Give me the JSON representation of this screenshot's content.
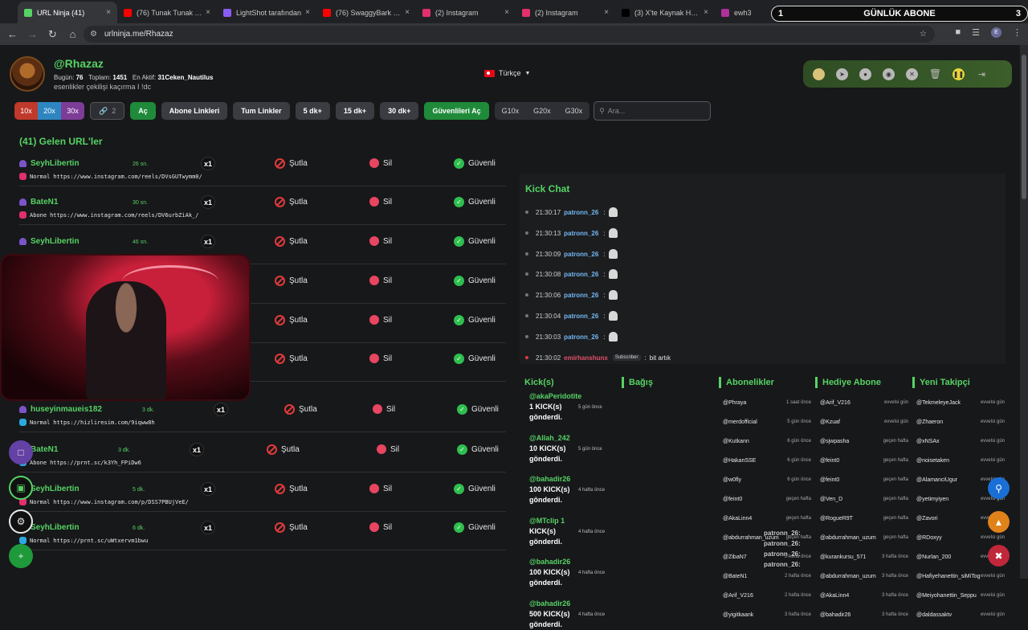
{
  "browser": {
    "tabs": [
      {
        "label": "URL Ninja (41)",
        "color": "#56d364",
        "active": true
      },
      {
        "label": "(76) Tunak Tunak Tun",
        "color": "#ff0000"
      },
      {
        "label": "LightShot tarafından",
        "color": "#8a5cf6"
      },
      {
        "label": "(76) SwaggyBark Kop",
        "color": "#ff0000"
      },
      {
        "label": "(2) Instagram",
        "color": "#e1306c"
      },
      {
        "label": "(2) Instagram",
        "color": "#e1306c"
      },
      {
        "label": "(3) X'te Kaynak Haber",
        "color": "#000000"
      },
      {
        "label": "ewh3",
        "color": "#b0309a"
      }
    ],
    "banner": {
      "left": "1",
      "text": "GÜNLÜK ABONE",
      "right": "3"
    },
    "url": "urlninja.me/Rhazaz"
  },
  "profile": {
    "username": "@Rhazaz",
    "today_label": "Bugün:",
    "today_value": "76",
    "total_label": "Toplam:",
    "total_value": "1451",
    "active_label": "En Aktif:",
    "active_value": "31Ceken_Nautilus",
    "tagline": "esenlikler çekilişi kaçırma I !dc",
    "language": "Türkçe"
  },
  "toolbar": {
    "mult": [
      {
        "label": "10x",
        "color": "#c0392b"
      },
      {
        "label": "20x",
        "color": "#2e86c1"
      },
      {
        "label": "30x",
        "color": "#7d3c98"
      }
    ],
    "link_count": "2",
    "open": "Aç",
    "sub_links": "Abone Linkleri",
    "all_links": "Tum Linkler",
    "t5": "5 dk+",
    "t15": "15 dk+",
    "t30": "30 dk+",
    "open_safe": "Güvenlileri Aç",
    "g10": "G10x",
    "g20": "G20x",
    "g30": "G30x",
    "search_placeholder": "Ara..."
  },
  "urls": {
    "title": "(41) Gelen URL'ler",
    "actions": {
      "ban": "Şutla",
      "del": "Sil",
      "safe": "Güvenli"
    },
    "rows": [
      {
        "user": "SeyhLibertin",
        "ago": "26 sn.",
        "badge": "x1",
        "type": "Normal",
        "url": "https://www.instagram.com/reels/DVsGUTwymm0/",
        "src": "ig"
      },
      {
        "user": "BateN1",
        "ago": "30 sn.",
        "badge": "x1",
        "type": "Abone",
        "url": "https://www.instagram.com/reels/DV6urbZiAk_/",
        "src": "ig"
      },
      {
        "user": "SeyhLibertin",
        "ago": "46 sn.",
        "badge": "x1",
        "type": "",
        "url": "",
        "src": ""
      },
      {
        "user": "",
        "ago": "",
        "badge": "",
        "type": "",
        "url": "",
        "src": ""
      },
      {
        "user": "",
        "ago": "",
        "badge": "",
        "type": "",
        "url": "",
        "src": ""
      },
      {
        "user": "",
        "ago": "",
        "badge": "",
        "type": "",
        "url": "",
        "src": ""
      },
      {
        "user": "huseyinmaueis182",
        "ago": "3 dk.",
        "badge": "x1",
        "type": "Normal",
        "url": "https://hizliresim.com/9iqww8h",
        "src": "tw"
      },
      {
        "user": "BateN1",
        "ago": "3 dk.",
        "badge": "x1",
        "type": "Abone",
        "url": "https://prnt.sc/k3Yh_FPiDw6",
        "src": "tw"
      },
      {
        "user": "SeyhLibertin",
        "ago": "5 dk.",
        "badge": "x1",
        "type": "Normal",
        "url": "https://www.instagram.com/p/DSS7PBUjVeE/",
        "src": "ig"
      },
      {
        "user": "SeyhLibertin",
        "ago": "6 dk.",
        "badge": "x1",
        "type": "Normal",
        "url": "https://prnt.sc/uWtxervm1bwu",
        "src": "tw"
      }
    ]
  },
  "chat": {
    "title": "Kick Chat",
    "messages": [
      {
        "time": "21:30:17",
        "nick": "patronn_26",
        "sep": ":",
        "text": ""
      },
      {
        "time": "21:30:13",
        "nick": "patronn_26",
        "sep": ":",
        "text": ""
      },
      {
        "time": "21:30:09",
        "nick": "patronn_26",
        "sep": ":",
        "text": ""
      },
      {
        "time": "21:30:08",
        "nick": "patronn_26",
        "sep": ":",
        "text": ""
      },
      {
        "time": "21:30:06",
        "nick": "patronn_26",
        "sep": ":",
        "text": ""
      },
      {
        "time": "21:30:04",
        "nick": "patronn_26",
        "sep": ":",
        "text": ""
      },
      {
        "time": "21:30:03",
        "nick": "patronn_26",
        "sep": ":",
        "text": ""
      },
      {
        "time": "21:30:02",
        "nick": "emirhanshunx",
        "badge": "Subscriber",
        "sep": ":",
        "text": "bit artık"
      }
    ]
  },
  "kicks": {
    "title": "Kick(s)",
    "items": [
      {
        "name": "@akaPeridotite",
        "line1": "1 KICK(s)",
        "line2": "gönderdi.",
        "when": "5 gün önce"
      },
      {
        "name": "@Allah_242",
        "line1": "10 KICK(s)",
        "line2": "gönderdi.",
        "when": "5 gün önce"
      },
      {
        "name": "@bahadir26",
        "line1": "100 KICK(s)",
        "line2": "gönderdi.",
        "when": "4 hafta önce"
      },
      {
        "name": "@MTclip 1",
        "line1": "KICK(s)",
        "line2": "gönderdi.",
        "when": "4 hafta önce"
      },
      {
        "name": "@bahadir26",
        "line1": "100 KICK(s)",
        "line2": "gönderdi.",
        "when": "4 hafta önce"
      },
      {
        "name": "@bahadir26",
        "line1": "500 KICK(s)",
        "line2": "gönderdi.",
        "when": "4 hafta önce"
      }
    ]
  },
  "donations": {
    "title": "Bağış"
  },
  "subs": {
    "title": "Abonelikler",
    "items": [
      {
        "n": "@Phraya",
        "w": "1 saat önce"
      },
      {
        "n": "@merdofficial",
        "w": "5 gün önce"
      },
      {
        "n": "@Kutkann",
        "w": "6 gün önce"
      },
      {
        "n": "@HakanSSE",
        "w": "6 gün önce"
      },
      {
        "n": "@w0fly",
        "w": "6 gün önce"
      },
      {
        "n": "@feint0",
        "w": "geçen hafta"
      },
      {
        "n": "@AkaLinn4",
        "w": "geçen hafta"
      },
      {
        "n": "@abdurrahman_uzum",
        "w": "geçen hafta"
      },
      {
        "n": "@ZibaN7",
        "w": "2 hafta önce"
      },
      {
        "n": "@BateN1",
        "w": "2 hafta önce"
      },
      {
        "n": "@Arif_V216",
        "w": "2 hafta önce"
      },
      {
        "n": "@yigitkaank",
        "w": "3 hafta önce"
      }
    ]
  },
  "gift_subs": {
    "title": "Hediye Abone",
    "items": [
      {
        "n": "@Arif_V216",
        "w": "evvelsi gün"
      },
      {
        "n": "@Kzuaf",
        "w": "evvelsi gün"
      },
      {
        "n": "@sjwpasha",
        "w": "geçen hafta"
      },
      {
        "n": "@feint0",
        "w": "geçen hafta"
      },
      {
        "n": "@feint0",
        "w": "geçen hafta"
      },
      {
        "n": "@Ven_D",
        "w": "geçen hafta"
      },
      {
        "n": "@RogueR9T",
        "w": "geçen hafta"
      },
      {
        "n": "@abdurrahman_uzum",
        "w": "geçen hafta"
      },
      {
        "n": "@kurankursu_571",
        "w": "3 hafta önce"
      },
      {
        "n": "@abdurrahman_uzum",
        "w": "3 hafta önce"
      },
      {
        "n": "@AkaLinn4",
        "w": "3 hafta önce"
      },
      {
        "n": "@bahadir26",
        "w": "3 hafta önce"
      }
    ]
  },
  "followers": {
    "title": "Yeni Takipçi",
    "items": [
      {
        "n": "@TekmeleyeJack",
        "w": "evvelsi gün"
      },
      {
        "n": "@Zhaeron",
        "w": "evvelsi gün"
      },
      {
        "n": "@xNSAx",
        "w": "evvelsi gün"
      },
      {
        "n": "@noisetaken",
        "w": "evvelsi gün"
      },
      {
        "n": "@AlamanciUgur",
        "w": "evvelsi gün"
      },
      {
        "n": "@yetimyiyen",
        "w": "evvelsi gün"
      },
      {
        "n": "@Zavori",
        "w": "evvelsi gün"
      },
      {
        "n": "@RDoxyy",
        "w": "evvelsi gün"
      },
      {
        "n": "@Nurlan_200",
        "w": "evvelsi gün"
      },
      {
        "n": "@Hafiyehanettin_siMiTog",
        "w": "evvelsi gün"
      },
      {
        "n": "@Meiyohanettin_Seppu",
        "w": "evvelsi gün"
      },
      {
        "n": "@daldassaktv",
        "w": "evvelsi gün"
      }
    ]
  },
  "overlay_chat": [
    {
      "nick": "patronn_26:"
    },
    {
      "nick": "patronn_26:"
    },
    {
      "nick": "patronn_26:"
    },
    {
      "nick": "patronn_26:"
    }
  ]
}
